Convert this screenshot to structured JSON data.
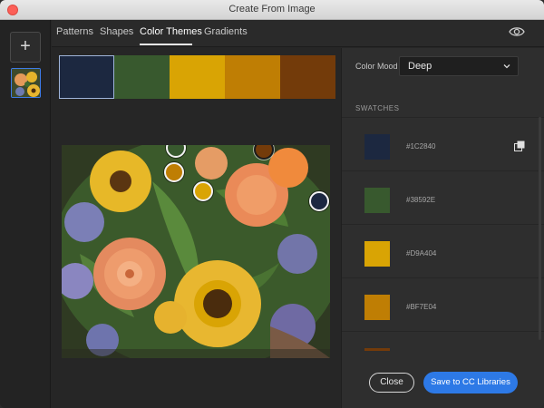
{
  "window": {
    "title": "Create From Image"
  },
  "left_toolbar": {
    "add_label": "+"
  },
  "tabs": [
    {
      "label": "Patterns",
      "active": false
    },
    {
      "label": "Shapes",
      "active": false
    },
    {
      "label": "Color Themes",
      "active": true
    },
    {
      "label": "Gradients",
      "active": false
    }
  ],
  "icons": {
    "preview": "eye-icon",
    "dropdown": "chevron-down-icon",
    "copy": "copy-icon",
    "add": "plus-icon"
  },
  "palette": {
    "colors": [
      "#1C2840",
      "#38592E",
      "#D9A404",
      "#BF7E04",
      "#733B0A"
    ],
    "selected_index": 0
  },
  "color_mood": {
    "label": "Color Mood",
    "value": "Deep"
  },
  "swatches": {
    "heading": "SWATCHES",
    "items": [
      {
        "color": "#1C2840",
        "hex": "#1C2840"
      },
      {
        "color": "#38592E",
        "hex": "#38592E"
      },
      {
        "color": "#D9A404",
        "hex": "#D9A404"
      },
      {
        "color": "#BF7E04",
        "hex": "#BF7E04"
      },
      {
        "color": "#733B0A",
        "hex": ""
      }
    ]
  },
  "buttons": {
    "close": "Close",
    "save": "Save to CC Libraries"
  }
}
